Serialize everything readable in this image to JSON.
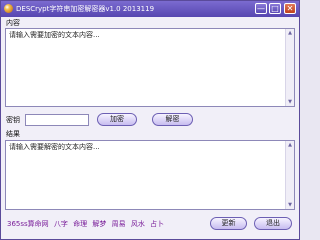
{
  "window": {
    "title": "DESCrypt字符串加密解密器v1.0 2013119",
    "min": "—",
    "max": "□",
    "close": "✕"
  },
  "content": {
    "label": "内容",
    "placeholder": "请输入需要加密的文本内容..."
  },
  "key": {
    "label": "密钥",
    "value": ""
  },
  "buttons": {
    "encrypt": "加密",
    "decrypt": "解密",
    "update": "更新",
    "exit": "退出"
  },
  "result": {
    "label": "结果",
    "placeholder": "请输入需要解密的文本内容..."
  },
  "footer": {
    "links": [
      "365ss算命网",
      "八字",
      "命理",
      "解梦",
      "周易",
      "风水",
      "占卜"
    ]
  },
  "colors": {
    "titlebar": "#6454c0",
    "link": "#7a1f9a"
  }
}
